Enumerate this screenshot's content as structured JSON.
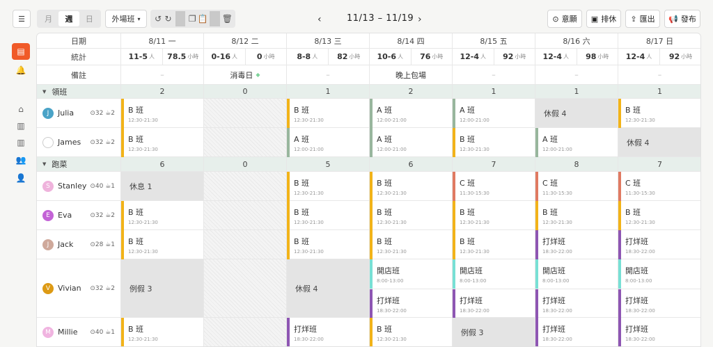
{
  "toolbar": {
    "view_month": "月",
    "view_week": "週",
    "view_day": "日",
    "shift_select": "外場班",
    "range": "11/13 – 11/19",
    "wish_label": "意願",
    "schedule_label": "排休",
    "export_label": "匯出",
    "publish_label": "發布"
  },
  "header": {
    "date_label": "日期",
    "stats_label": "統計",
    "notes_label": "備註",
    "days": [
      "8/11 一",
      "8/12 二",
      "8/13 三",
      "8/14 四",
      "8/15 五",
      "8/16 六",
      "8/17 日"
    ]
  },
  "stats": [
    {
      "people": "11-5",
      "people_unit": "人",
      "hours": "78.5",
      "hours_unit": "小時"
    },
    {
      "people": "0-16",
      "people_unit": "人",
      "hours": "0",
      "hours_unit": "小時"
    },
    {
      "people": "8-8",
      "people_unit": "人",
      "hours": "82",
      "hours_unit": "小時"
    },
    {
      "people": "10-6",
      "people_unit": "人",
      "hours": "76",
      "hours_unit": "小時"
    },
    {
      "people": "12-4",
      "people_unit": "人",
      "hours": "92",
      "hours_unit": "小時"
    },
    {
      "people": "12-4",
      "people_unit": "人",
      "hours": "98",
      "hours_unit": "小時"
    },
    {
      "people": "12-4",
      "people_unit": "人",
      "hours": "92",
      "hours_unit": "小時"
    }
  ],
  "notes": [
    "–",
    "消毒日",
    "–",
    "晚上包場",
    "–",
    "–",
    "–"
  ],
  "groups": {
    "lead": {
      "name": "領班",
      "counts": [
        "2",
        "0",
        "1",
        "2",
        "1",
        "1",
        "1"
      ]
    },
    "runner": {
      "name": "跑菜",
      "counts": [
        "6",
        "0",
        "5",
        "6",
        "7",
        "8",
        "7"
      ]
    }
  },
  "employees": [
    {
      "name": "Julia",
      "initial": "J",
      "hours": "32",
      "days": "2",
      "avatar_color": "#4aa3c7"
    },
    {
      "name": "James",
      "initial": "",
      "hours": "32",
      "days": "2",
      "avatar_color": "#ffffff"
    },
    {
      "name": "Stanley",
      "initial": "S",
      "hours": "40",
      "days": "1",
      "avatar_color": "#efb3dc"
    },
    {
      "name": "Eva",
      "initial": "E",
      "hours": "32",
      "days": "2",
      "avatar_color": "#c363d6"
    },
    {
      "name": "Jack",
      "initial": "J",
      "hours": "28",
      "days": "1",
      "avatar_color": "#cfa99b"
    },
    {
      "name": "Vivian",
      "initial": "V",
      "hours": "32",
      "days": "2",
      "avatar_color": "#dd9a14"
    },
    {
      "name": "Millie",
      "initial": "M",
      "hours": "40",
      "days": "1",
      "avatar_color": "#f0b4e0"
    }
  ],
  "shifts": {
    "b": {
      "name": "B 班",
      "time": "12:30-21:30",
      "color": "#f2b319"
    },
    "a": {
      "name": "A 班",
      "time": "12:00-21:00",
      "color": "#98b69d"
    },
    "c": {
      "name": "C 班",
      "time": "11:30-15:30",
      "color": "#e07a62"
    },
    "close": {
      "name": "打烊班",
      "time": "18:30-22:00",
      "color": "#8e56b3"
    },
    "open": {
      "name": "開店班",
      "time": "8:00-13:00",
      "color": "#78e0d5"
    }
  },
  "leave": {
    "vac4": "休假 4",
    "rest1": "休息 1",
    "reg3": "例假 3"
  },
  "colors": {
    "accent": "#f05a28",
    "group_bg": "#e7efeb"
  }
}
